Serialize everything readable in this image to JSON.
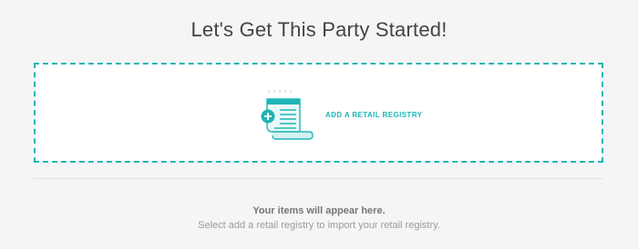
{
  "header": {
    "title": "Let's Get This Party Started!"
  },
  "add_registry": {
    "label": "ADD A RETAIL REGISTRY",
    "icon": "registry-scroll-plus-icon",
    "accent_color": "#20b5b5"
  },
  "empty_state": {
    "title": "Your items will appear here.",
    "subtitle": "Select add a retail registry to import your retail registry."
  }
}
